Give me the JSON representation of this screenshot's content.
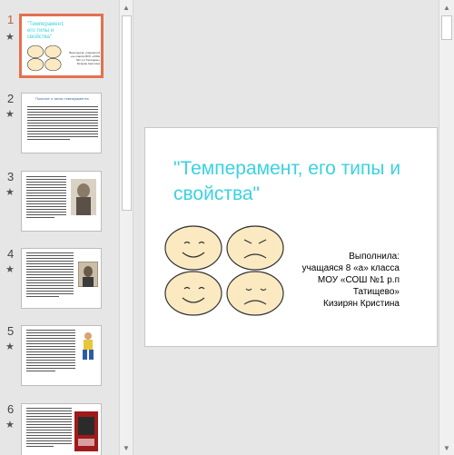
{
  "thumbnails": [
    {
      "number": "1",
      "star": "★",
      "title": "\"Темперамент, его типы и свойства\"",
      "author": "Выполнила: учащаяся 8 «а» класса МОУ «СОШ №1 р.п Татищево» Кизирян Кристина"
    },
    {
      "number": "2",
      "star": "★",
      "title": "Понятие о типах темперамента"
    },
    {
      "number": "3",
      "star": "★"
    },
    {
      "number": "4",
      "star": "★"
    },
    {
      "number": "5",
      "star": "★"
    },
    {
      "number": "6",
      "star": "★"
    }
  ],
  "main_slide": {
    "title": "\"Темперамент, его типы и свойства\"",
    "author_lines": [
      "Выполнила:",
      "учащаяся 8 «а» класса",
      "МОУ «СОШ №1 р.п",
      "Татищево»",
      "Кизирян Кристина"
    ]
  },
  "scroll": {
    "up": "▲",
    "down": "▼"
  },
  "colors": {
    "accent": "#e4704f",
    "title": "#3ad2e0",
    "face_fill": "#fbeac1"
  }
}
